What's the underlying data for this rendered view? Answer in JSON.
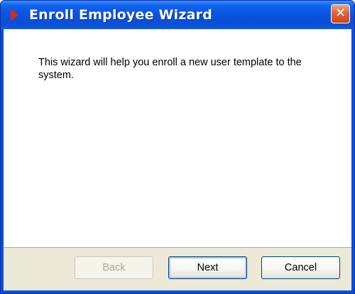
{
  "window": {
    "title": "Enroll Employee Wizard",
    "close_glyph": "✕"
  },
  "content": {
    "message": "This wizard will help you enroll a new user template to the system."
  },
  "buttons": {
    "back": "Back",
    "next": "Next",
    "cancel": "Cancel"
  },
  "colors": {
    "titlebar": "#0a4fd6",
    "close_button": "#e0623d",
    "dialog_background": "#ece9d8"
  }
}
